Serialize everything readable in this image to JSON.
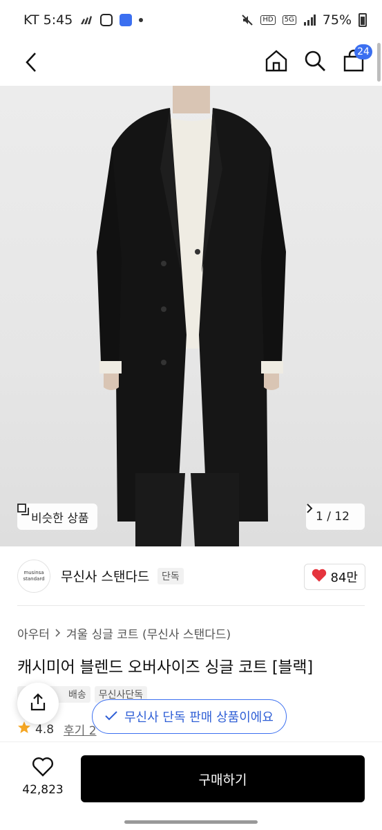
{
  "status_bar": {
    "carrier_time": "KT 5:45",
    "battery": "75%",
    "icons": [
      "adidas-icon",
      "instagram-icon",
      "app-icon",
      "dot-icon",
      "mute-icon",
      "hd-icon",
      "5g-icon",
      "signal-icon",
      "battery-icon"
    ]
  },
  "nav": {
    "cart_count": "24",
    "icons": [
      "back-icon",
      "home-icon",
      "search-icon",
      "cart-icon"
    ]
  },
  "hero": {
    "similar_label": "비슷한 상품",
    "pager_current": "1",
    "pager_sep": "/",
    "pager_total": "12"
  },
  "brand": {
    "logo_line1": "musinsa",
    "logo_line2": "standard",
    "name": "무신사 스탠다드",
    "tag": "단독",
    "likes": "84만"
  },
  "breadcrumb": {
    "category": "아우터",
    "subcategory": "겨울 싱글 코트 (무신사 스탠다드)"
  },
  "product": {
    "title": "캐시미어 블렌드 오버사이즈 싱글 코트 [블랙]",
    "tags": [
      "배송",
      "무신사단독"
    ],
    "rating": "4.8",
    "review_label": "후기 2"
  },
  "toast": {
    "text": "무신사 단독 판매 상품이에요"
  },
  "bottom": {
    "wish_count": "42,823",
    "buy_label": "구매하기"
  },
  "colors": {
    "accent": "#3b6ff0",
    "heart": "#e5343d",
    "star": "#f5a623",
    "buy_button": "#000000"
  }
}
